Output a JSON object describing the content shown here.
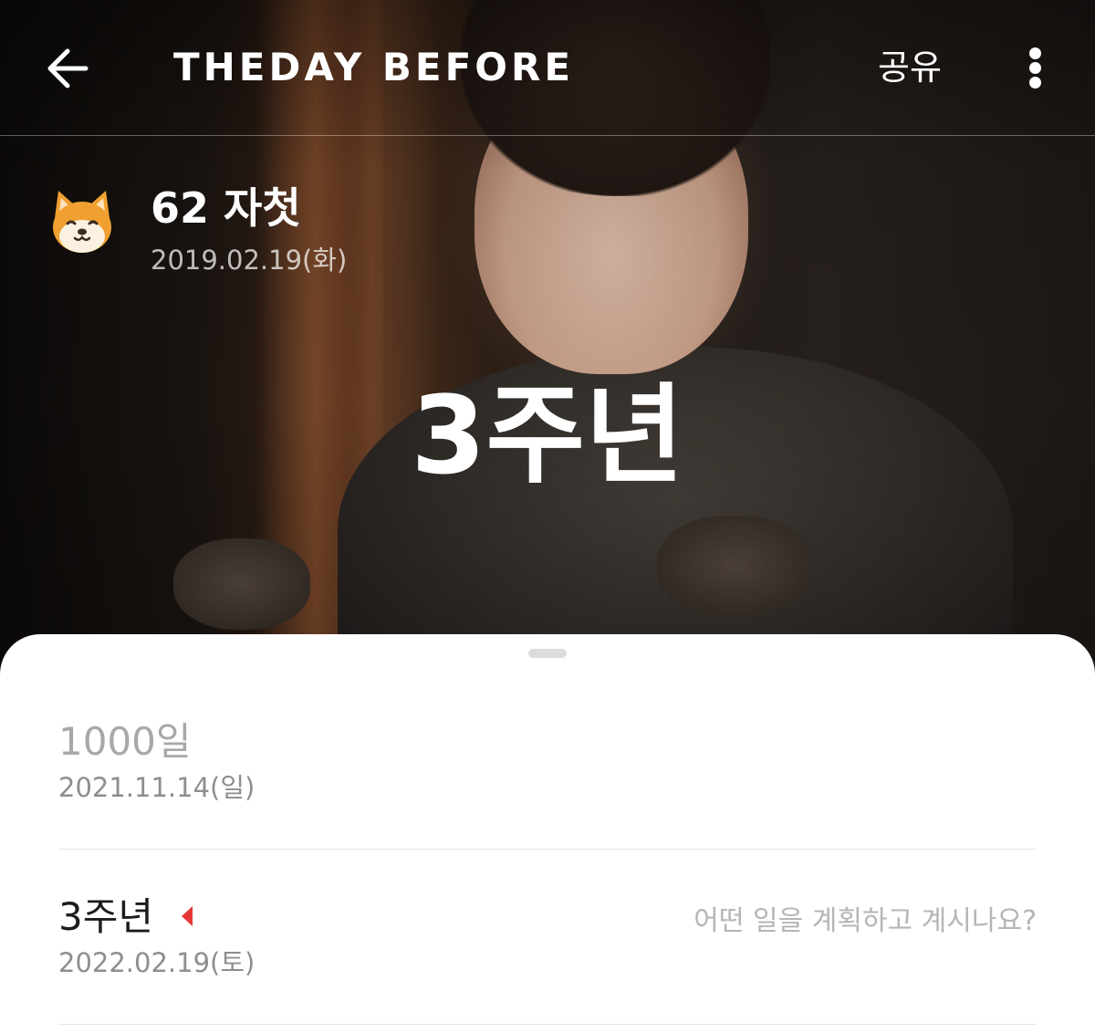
{
  "header": {
    "logo_text": "THEDAY BEFORE",
    "share_label": "공유",
    "back_icon": "arrow-left-icon",
    "more_icon": "more-vertical-icon"
  },
  "event": {
    "icon": "shiba-dog-emoji",
    "title": "62 자첫",
    "date": "2019.02.19(화)",
    "milestone": "3주년"
  },
  "milestones": [
    {
      "title": "1000일",
      "date": "2021.11.14(일)",
      "status": "past"
    },
    {
      "title": "3주년",
      "date": "2022.02.19(토)",
      "status": "today",
      "placeholder": "어떤 일을 계획하고 계시나요?"
    }
  ],
  "colors": {
    "accent": "#e53935",
    "sheet_background": "#ffffff",
    "past_text": "#a8a8a8",
    "placeholder_text": "#b5b5b5"
  }
}
